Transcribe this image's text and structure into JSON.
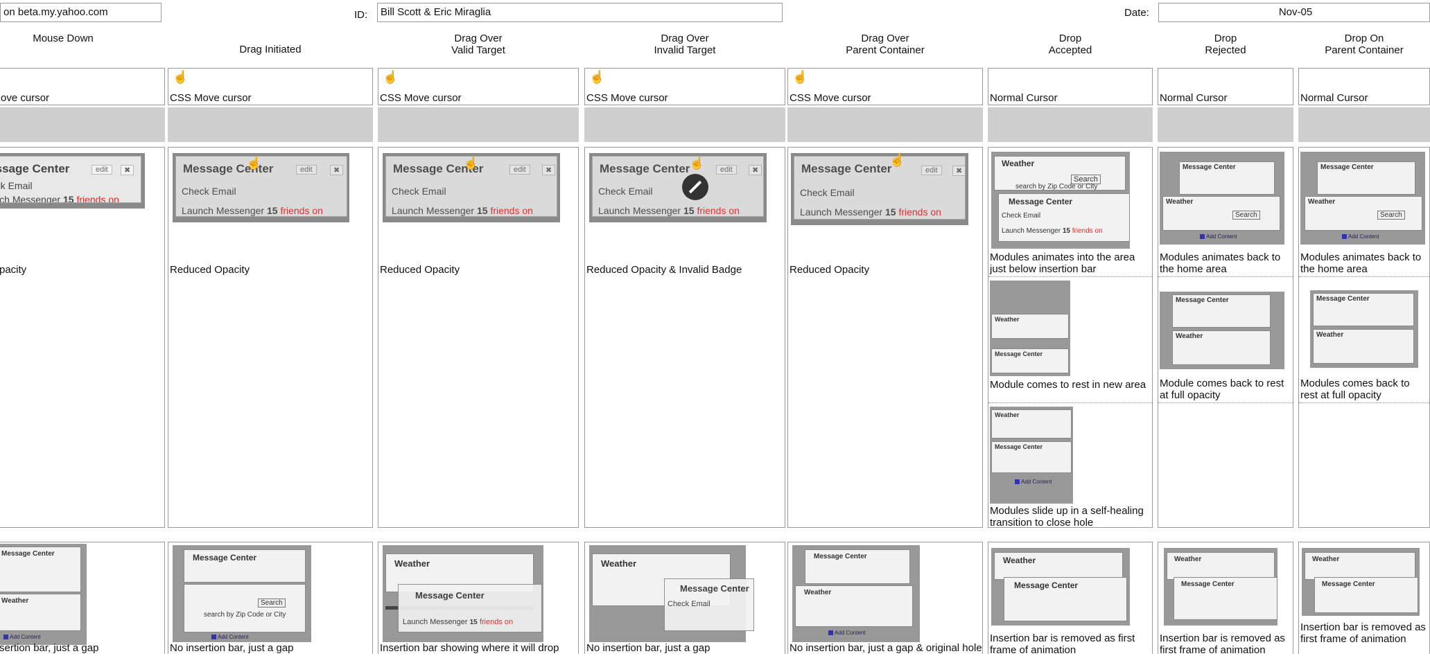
{
  "header": {
    "project_value": "on beta.my.yahoo.com",
    "id_label": "ID:",
    "id_value": "Bill Scott & Eric Miraglia",
    "date_label": "Date:",
    "date_value": "Nov-05"
  },
  "columns": [
    {
      "line1": "Mouse Down",
      "line2": ""
    },
    {
      "line1": "Drag Initiated",
      "line2": ""
    },
    {
      "line1": "Drag Over",
      "line2": "Valid Target"
    },
    {
      "line1": "Drag Over",
      "line2": "Invalid Target"
    },
    {
      "line1": "Drag Over",
      "line2": "Parent Container"
    },
    {
      "line1": "Drop",
      "line2": "Accepted"
    },
    {
      "line1": "Drop",
      "line2": "Rejected"
    },
    {
      "line1": "Drop On",
      "line2": "Parent Container"
    }
  ],
  "cursors": [
    "ove cursor",
    "CSS Move cursor",
    "CSS Move cursor",
    "CSS Move cursor",
    "CSS Move cursor",
    "Normal Cursor",
    "Normal Cursor",
    "Normal Cursor"
  ],
  "module": {
    "title": "Message Center",
    "edit": "edit",
    "close": "✖",
    "row1": "Check Email",
    "row2_prefix": "Launch Messenger",
    "row2_count": "15",
    "row2_suffix": "friends on",
    "weather_title": "Weather",
    "search_btn": "Search",
    "search_hint": "search by Zip Code or City",
    "add_content": "Add Content"
  },
  "opacity_captions": [
    "pacity",
    "Reduced Opacity",
    "Reduced Opacity",
    "Reduced Opacity & Invalid Badge",
    "Reduced Opacity"
  ],
  "accepted_captions": [
    "Modules animates into the area just below insertion bar",
    "Module comes to rest in new area",
    "Modules slide up in a self-healing transition to close hole"
  ],
  "rejected_captions": [
    "Modules animates back to the home area",
    "Module comes back to rest at full opacity"
  ],
  "parent_captions": [
    "Modules animates back to the home area",
    "Modules comes back to rest at full opacity"
  ],
  "bottom_captions": [
    "sertion bar, just a gap",
    "No insertion bar, just a gap",
    "Insertion bar showing where it will drop",
    "No insertion bar, just a gap",
    "No insertion bar, just a gap & original hole",
    "Insertion bar is removed as first frame of animation",
    "Insertion bar is removed as first frame of animation",
    "Insertion bar is removed as first frame of animation"
  ]
}
